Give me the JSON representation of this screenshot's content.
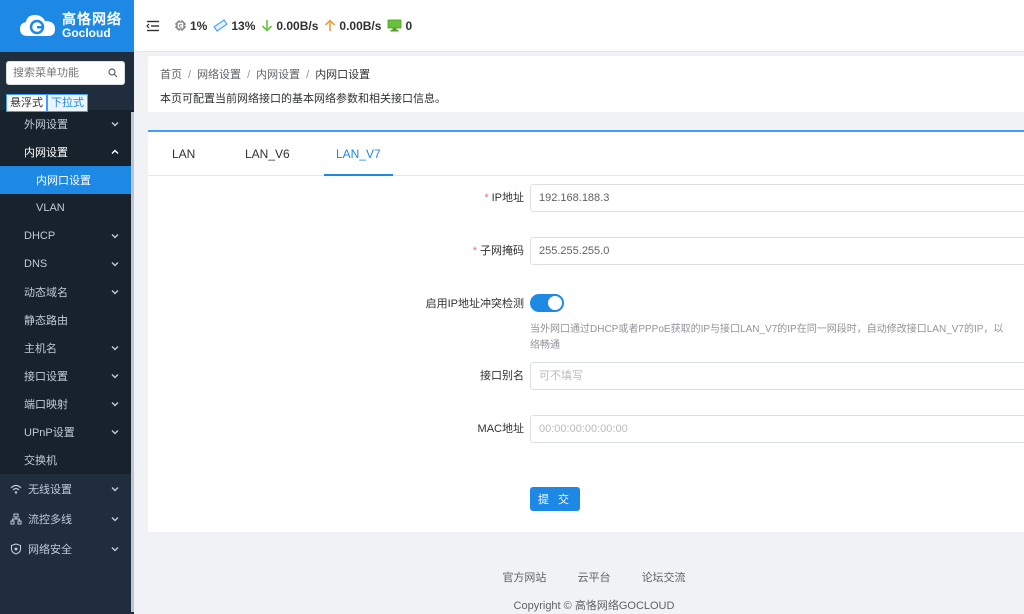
{
  "brand": {
    "cn": "高恪网络",
    "en": "Gocloud",
    "color": "#1e88e5"
  },
  "sidebar": {
    "search_placeholder": "搜索菜单功能",
    "mode_float": "悬浮式",
    "mode_dropdown": "下拉式",
    "items": [
      {
        "label": "外网设置"
      },
      {
        "label": "内网设置"
      },
      {
        "label": "内网口设置"
      },
      {
        "label": "VLAN"
      },
      {
        "label": "DHCP"
      },
      {
        "label": "DNS"
      },
      {
        "label": "动态域名"
      },
      {
        "label": "静态路由"
      },
      {
        "label": "主机名"
      },
      {
        "label": "接口设置"
      },
      {
        "label": "端口映射"
      },
      {
        "label": "UPnP设置"
      },
      {
        "label": "交换机"
      }
    ],
    "top_items": [
      {
        "label": "无线设置",
        "icon": "wifi-icon"
      },
      {
        "label": "流控多线",
        "icon": "flow-control-icon"
      },
      {
        "label": "网络安全",
        "icon": "shield-icon"
      }
    ]
  },
  "topbar": {
    "cpu": "1%",
    "memory": "13%",
    "download": "0.00B/s",
    "upload": "0.00B/s",
    "online": "0"
  },
  "breadcrumb": [
    "首页",
    "网络设置",
    "内网设置",
    "内网口设置"
  ],
  "description": "本页可配置当前网络接口的基本网络参数和相关接口信息。",
  "tabs": [
    "LAN",
    "LAN_V6",
    "LAN_V7"
  ],
  "active_tab": "LAN_V7",
  "form": {
    "ip_label": "IP地址",
    "ip_value": "192.168.188.3",
    "mask_label": "子网掩码",
    "mask_value": "255.255.255.0",
    "conflict_label": "启用IP地址冲突检测",
    "conflict_enabled": true,
    "conflict_hint": "当外网口通过DHCP或者PPPoE获取的IP与接口LAN_V7的IP在同一网段时，自动修改接口LAN_V7的IP，以",
    "conflict_hint2": "络畅通",
    "alias_label": "接口别名",
    "alias_placeholder": "可不填写",
    "mac_label": "MAC地址",
    "mac_placeholder": "00:00:00:00:00:00",
    "submit_label": "提 交"
  },
  "footer": {
    "links": [
      "官方网站",
      "云平台",
      "论坛交流"
    ],
    "copyright": "Copyright © 高恪网络GOCLOUD"
  }
}
